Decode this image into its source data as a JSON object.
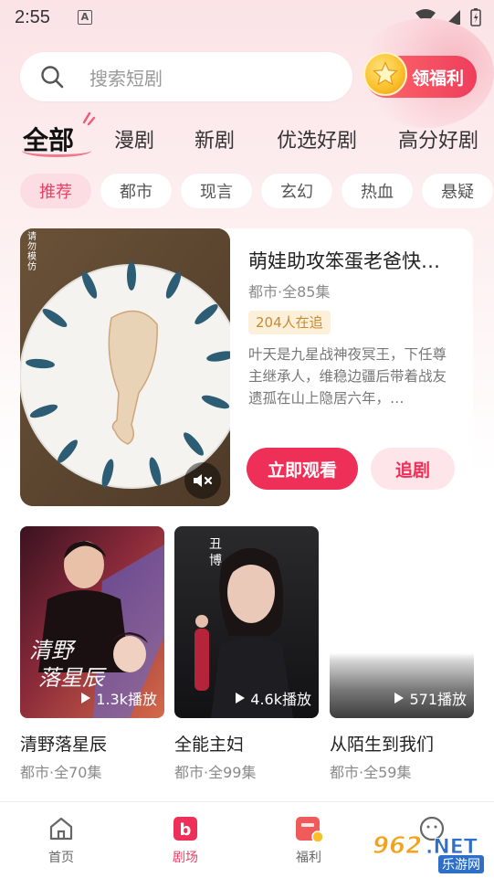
{
  "status_bar": {
    "time": "2:55",
    "notif_letter": "A"
  },
  "search": {
    "placeholder": "搜索短剧"
  },
  "welfare_button": {
    "label": "领福利"
  },
  "category_tabs": [
    {
      "label": "全部",
      "active": true
    },
    {
      "label": "漫剧"
    },
    {
      "label": "新剧"
    },
    {
      "label": "优选好剧"
    },
    {
      "label": "高分好剧"
    }
  ],
  "genre_chips": [
    {
      "label": "推荐",
      "active": true
    },
    {
      "label": "都市"
    },
    {
      "label": "现言"
    },
    {
      "label": "玄幻"
    },
    {
      "label": "热血"
    },
    {
      "label": "悬疑"
    }
  ],
  "featured": {
    "cover_note": "请勿模仿",
    "title": "萌娃助攻笨蛋老爸快…",
    "meta": "都市·全85集",
    "badge": "204人在追",
    "description": "叶天是九星战神夜冥王，下任尊主继承人，维稳边疆后带着战友遗孤在山上隐居六年，…",
    "watch_label": "立即观看",
    "follow_label": "追剧"
  },
  "dramas": [
    {
      "title": "清野落星辰",
      "meta": "都市·全70集",
      "plays": "1.3k播放",
      "cover_text": "清野落星辰"
    },
    {
      "title": "全能主妇",
      "meta": "都市·全99集",
      "plays": "4.6k播放",
      "cover_text": "丑博"
    },
    {
      "title": "从陌生到我们",
      "meta": "都市·全59集",
      "plays": "571播放"
    }
  ],
  "bottom_nav": [
    {
      "label": "首页",
      "icon": "home-icon"
    },
    {
      "label": "剧场",
      "icon": "theater-icon",
      "active": true
    },
    {
      "label": "福利",
      "icon": "gift-icon"
    }
  ],
  "watermark": {
    "text": "962.NET",
    "subtext": "乐游网"
  },
  "colors": {
    "accent": "#ee2f58",
    "chip_active_bg": "#fcdde3",
    "badge_bg": "#fdf0db"
  }
}
